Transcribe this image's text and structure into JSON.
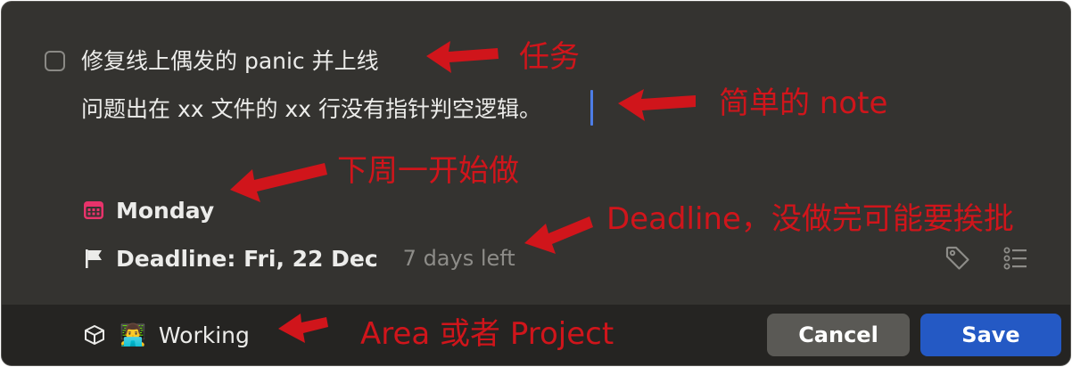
{
  "task": {
    "title": "修复线上偶发的 panic 并上线",
    "note": "问题出在 xx 文件的 xx 行没有指针判空逻辑。"
  },
  "when": {
    "label": "Monday",
    "icon": "calendar-icon",
    "color": "#e8336b"
  },
  "deadline": {
    "label": "Deadline: Fri, 22 Dec",
    "remaining": "7 days left",
    "icon": "flag-icon"
  },
  "toolbar": {
    "tag_icon": "tag-icon",
    "checklist_icon": "checklist-icon"
  },
  "footer": {
    "area_icon": "box-icon",
    "area_emoji": "👨‍💻",
    "area_label": "Working",
    "cancel_label": "Cancel",
    "save_label": "Save"
  },
  "annotations": {
    "task": "任务",
    "note": "简单的 note",
    "start": "下周一开始做",
    "deadline": "Deadline，没做完可能要挨批",
    "area": "Area 或者 Project",
    "color": "#d0151b"
  },
  "colors": {
    "window_bg": "#343330",
    "footer_bg": "#252422",
    "save_button": "#2459c4",
    "cancel_button": "#5a5955",
    "caret": "#4d7de6"
  }
}
